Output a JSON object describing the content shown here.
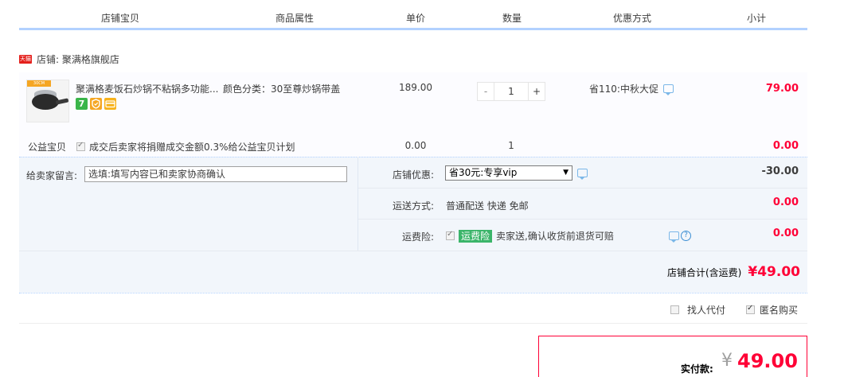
{
  "header": {
    "columns": [
      "店铺宝贝",
      "商品属性",
      "单价",
      "数量",
      "优惠方式",
      "小计"
    ]
  },
  "shop": {
    "badge": "天猫",
    "label": "店铺: 聚满格旗舰店"
  },
  "item": {
    "image_tag": "30CM",
    "title": "聚满格麦饭石炒锅不粘锅多功能...",
    "sku": "颜色分类：30至尊炒锅带盖",
    "price": "189.00",
    "qty_minus": "-",
    "qty_value": "1",
    "qty_plus": "+",
    "promo": "省110:中秋大促",
    "subtotal": "79.00",
    "badge_icons": [
      "seven-day-return-icon",
      "guarantee-icon",
      "credit-card-icon"
    ],
    "badge_7": "7"
  },
  "charity": {
    "label": "公益宝贝",
    "desc": "成交后卖家将捐赠成交金额0.3%给公益宝贝计划",
    "price": "0.00",
    "qty": "1",
    "subtotal": "0.00"
  },
  "message": {
    "label": "给卖家留言:",
    "value": "选填:填写内容已和卖家协商确认"
  },
  "shop_discount": {
    "label": "店铺优惠:",
    "selected": "省30元:专享vip",
    "amount": "-30.00"
  },
  "shipping": {
    "label": "运送方式:",
    "value": "普通配送 快递 免邮",
    "amount": "0.00"
  },
  "insurance": {
    "label": "运费险:",
    "tag": "运费险",
    "desc": "卖家送,确认收货前退货可赔",
    "amount": "0.00",
    "help": "?"
  },
  "shop_total": {
    "label": "店铺合计(含运费)",
    "value": "¥49.00"
  },
  "options": {
    "proxy_pay": "找人代付",
    "anonymous": "匿名购买"
  },
  "payment": {
    "label": "实付款:",
    "currency": "¥",
    "value": "49.00"
  },
  "colors": {
    "accent_red": "#ff0036",
    "header_border": "#b2d1ff",
    "insurance_green": "#3bb56a"
  }
}
